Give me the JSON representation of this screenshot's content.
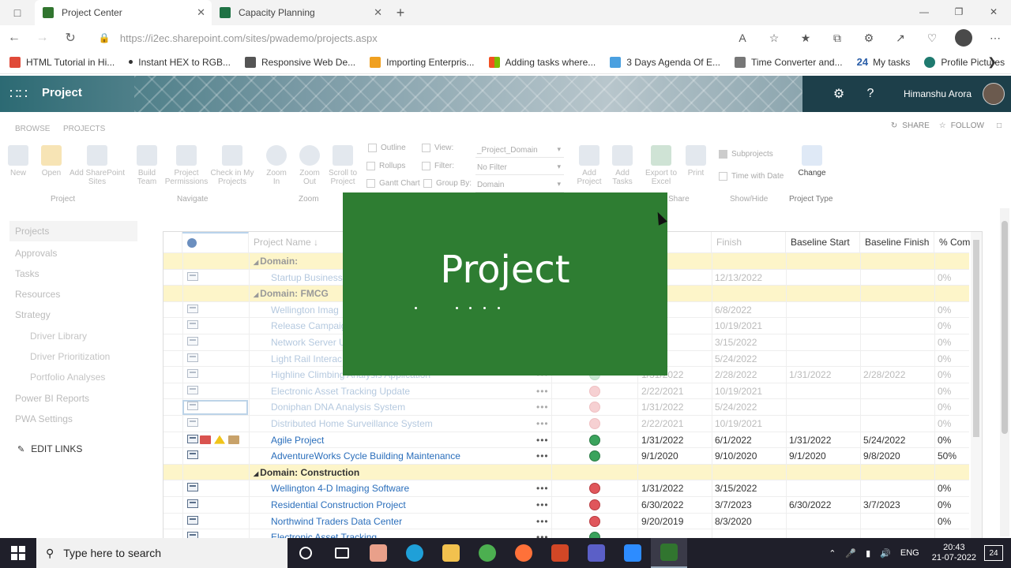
{
  "browser": {
    "tabs": [
      {
        "label": "Project Center",
        "active": true
      },
      {
        "label": "Capacity Planning",
        "active": false
      }
    ],
    "url": "https://i2ec.sharepoint.com/sites/pwademo/projects.aspx",
    "favorites": [
      {
        "label": "HTML Tutorial in Hi...",
        "color": "#e04a39"
      },
      {
        "label": "Instant HEX to RGB...",
        "color": "#333333"
      },
      {
        "label": "Responsive Web De...",
        "color": "#555555"
      },
      {
        "label": "Importing Enterpris...",
        "color": "#f0a020"
      },
      {
        "label": "Adding tasks where...",
        "color": "#3b7bd6"
      },
      {
        "label": "3 Days Agenda Of E...",
        "color": "#4aa0e0"
      },
      {
        "label": "Time Converter and...",
        "color": "#777777"
      },
      {
        "label": "My tasks",
        "color": "#2a5ea8"
      },
      {
        "label": "Profile Pictures",
        "color": "#1f7a6f"
      }
    ]
  },
  "suite": {
    "app_title": "Project",
    "user_name": "Himanshu Arora"
  },
  "ribbon": {
    "tabs": [
      "BROWSE",
      "PROJECTS"
    ],
    "share": "SHARE",
    "follow": "FOLLOW",
    "buttons": {
      "new": "New",
      "open": "Open",
      "add_sharepoint_sites": "Add SharePoint Sites",
      "build_team": "Build Team",
      "project_permissions": "Project Permissions",
      "check_in": "Check in My Projects",
      "zoom_in": "Zoom In",
      "zoom_out": "Zoom Out",
      "scroll_to_project": "Scroll to Project",
      "add_project": "Add Project",
      "add_tasks": "Add Tasks",
      "export_excel": "Export to Excel",
      "print": "Print",
      "change": "Change"
    },
    "small": {
      "outline": "Outline",
      "view": "View:",
      "rollups": "Rollups",
      "filter": "Filter:",
      "gantt_chart": "Gantt Chart",
      "group_by": "Group By:",
      "subprojects": "Subprojects",
      "time_with_date": "Time with Date"
    },
    "selects": {
      "view": "_Project_Domain",
      "filter": "No Filter",
      "group_by": "Domain"
    },
    "groups": {
      "project": "Project",
      "navigate": "Navigate",
      "zoom": "Zoom",
      "share": "Share",
      "show_hide": "Show/Hide",
      "project_type": "Project Type"
    }
  },
  "leftnav": {
    "items": [
      "Projects",
      "Approvals",
      "Tasks",
      "Resources",
      "Strategy"
    ],
    "sub_items": [
      "Driver Library",
      "Driver Prioritization",
      "Portfolio Analyses"
    ],
    "bottom_items": [
      "Power BI Reports",
      "PWA Settings"
    ],
    "edit_links": "EDIT LINKS"
  },
  "grid": {
    "headers": {
      "project_name": "Project Name ↓",
      "finish": "Finish",
      "baseline_start": "Baseline Start",
      "baseline_finish": "Baseline Finish",
      "pct_complete": "% Com"
    },
    "rows": [
      {
        "kind": "group",
        "label": "Domain:",
        "faded": true
      },
      {
        "kind": "item",
        "name": "Startup Business",
        "status": "",
        "start": "022",
        "finish": "12/13/2022",
        "bstart": "",
        "bfinish": "",
        "pct": "0%",
        "faded": true
      },
      {
        "kind": "group",
        "label": "Domain: FMCG",
        "faded": true
      },
      {
        "kind": "item",
        "name": "Wellington Imag",
        "status": "",
        "start": "022",
        "finish": "6/8/2022",
        "bstart": "",
        "bfinish": "",
        "pct": "0%",
        "faded": true
      },
      {
        "kind": "item",
        "name": "Release Campaig",
        "status": "",
        "start": "021",
        "finish": "10/19/2021",
        "bstart": "",
        "bfinish": "",
        "pct": "0%",
        "faded": true
      },
      {
        "kind": "item",
        "name": "Network Server U",
        "status": "",
        "start": "022",
        "finish": "3/15/2022",
        "bstart": "",
        "bfinish": "",
        "pct": "0%",
        "faded": true
      },
      {
        "kind": "item",
        "name": "Light Rail Interac",
        "status": "",
        "start": "022",
        "finish": "5/24/2022",
        "bstart": "",
        "bfinish": "",
        "pct": "0%",
        "faded": true
      },
      {
        "kind": "item",
        "name": "Highline Climbing Analysis Application",
        "status": "green",
        "start": "1/31/2022",
        "finish": "2/28/2022",
        "bstart": "1/31/2022",
        "bfinish": "2/28/2022",
        "pct": "0%",
        "faded": true
      },
      {
        "kind": "item",
        "name": "Electronic Asset Tracking Update",
        "status": "red",
        "start": "2/22/2021",
        "finish": "10/19/2021",
        "bstart": "",
        "bfinish": "",
        "pct": "0%",
        "faded": true
      },
      {
        "kind": "item",
        "name": "Doniphan DNA Analysis System",
        "status": "red",
        "start": "1/31/2022",
        "finish": "5/24/2022",
        "bstart": "",
        "bfinish": "",
        "pct": "0%",
        "faded": true
      },
      {
        "kind": "item",
        "name": "Distributed Home Surveillance System",
        "status": "red",
        "start": "2/22/2021",
        "finish": "10/19/2021",
        "bstart": "",
        "bfinish": "",
        "pct": "0%",
        "faded": true
      },
      {
        "kind": "item",
        "name": "Agile Project",
        "status": "green",
        "start": "1/31/2022",
        "finish": "6/1/2022",
        "bstart": "1/31/2022",
        "bfinish": "5/24/2022",
        "pct": "0%",
        "faded": false,
        "indicators": true
      },
      {
        "kind": "item",
        "name": "AdventureWorks Cycle Building Maintenance",
        "status": "green",
        "start": "9/1/2020",
        "finish": "9/10/2020",
        "bstart": "9/1/2020",
        "bfinish": "9/8/2020",
        "pct": "50%",
        "faded": false
      },
      {
        "kind": "group",
        "label": "Domain: Construction",
        "faded": false
      },
      {
        "kind": "item",
        "name": "Wellington 4-D Imaging Software",
        "status": "red",
        "start": "1/31/2022",
        "finish": "3/15/2022",
        "bstart": "",
        "bfinish": "",
        "pct": "0%",
        "faded": false
      },
      {
        "kind": "item",
        "name": "Residential Construction Project",
        "status": "red",
        "start": "6/30/2022",
        "finish": "3/7/2023",
        "bstart": "6/30/2022",
        "bfinish": "3/7/2023",
        "pct": "0%",
        "faded": false
      },
      {
        "kind": "item",
        "name": "Northwind Traders Data Center",
        "status": "red",
        "start": "9/20/2019",
        "finish": "8/3/2020",
        "bstart": "",
        "bfinish": "",
        "pct": "0%",
        "faded": false
      },
      {
        "kind": "item",
        "name": "Electronic Asset Tracking",
        "status": "green",
        "start": "",
        "finish": "",
        "bstart": "",
        "bfinish": "",
        "pct": "",
        "faded": false
      }
    ]
  },
  "splash": {
    "title": "Project",
    "bg_color": "#2e7d32"
  },
  "taskbar": {
    "search_placeholder": "Type here to search",
    "lang": "ENG",
    "time": "20:43",
    "date": "21-07-2022",
    "notif_count": "24",
    "apps": [
      {
        "icon": "cortana-icon",
        "color": "#1f1f2a"
      },
      {
        "icon": "task-view-icon",
        "color": "#1f1f2a"
      },
      {
        "icon": "scratch-icon",
        "color": "#e9a08a"
      },
      {
        "icon": "edge-icon",
        "color": "#1fa0d8"
      },
      {
        "icon": "file-explorer-icon",
        "color": "#f2c14e"
      },
      {
        "icon": "chrome-icon",
        "color": "#4caf50"
      },
      {
        "icon": "firefox-icon",
        "color": "#ff7139"
      },
      {
        "icon": "powerpoint-icon",
        "color": "#d24726"
      },
      {
        "icon": "teams-icon",
        "color": "#5b5fc7"
      },
      {
        "icon": "zoom-icon",
        "color": "#2d8cff"
      },
      {
        "icon": "project-icon",
        "color": "#31752f"
      }
    ]
  }
}
